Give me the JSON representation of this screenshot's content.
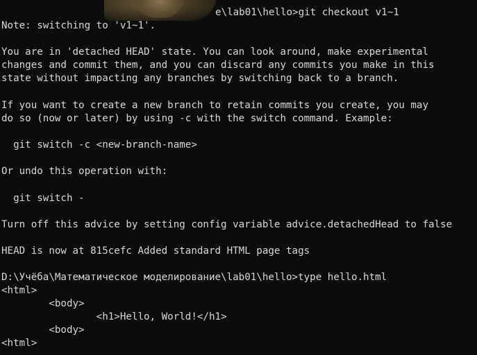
{
  "terminal": {
    "command_line_tail": "e\\lab01\\hello>git checkout v1~1",
    "lines": [
      "Note: switching to 'v1~1'.",
      "",
      "You are in 'detached HEAD' state. You can look around, make experimental",
      "changes and commit them, and you can discard any commits you make in this",
      "state without impacting any branches by switching back to a branch.",
      "",
      "If you want to create a new branch to retain commits you create, you may",
      "do so (now or later) by using -c with the switch command. Example:",
      "",
      "  git switch -c <new-branch-name>",
      "",
      "Or undo this operation with:",
      "",
      "  git switch -",
      "",
      "Turn off this advice by setting config variable advice.detachedHead to false",
      "",
      "HEAD is now at 815cefc Added standard HTML page tags",
      "",
      "D:\\Учёба\\Математическое моделирование\\lab01\\hello>type hello.html",
      "<html>",
      "        <body>",
      "                <h1>Hello, World!</h1>",
      "        <body>",
      "<html>"
    ]
  }
}
